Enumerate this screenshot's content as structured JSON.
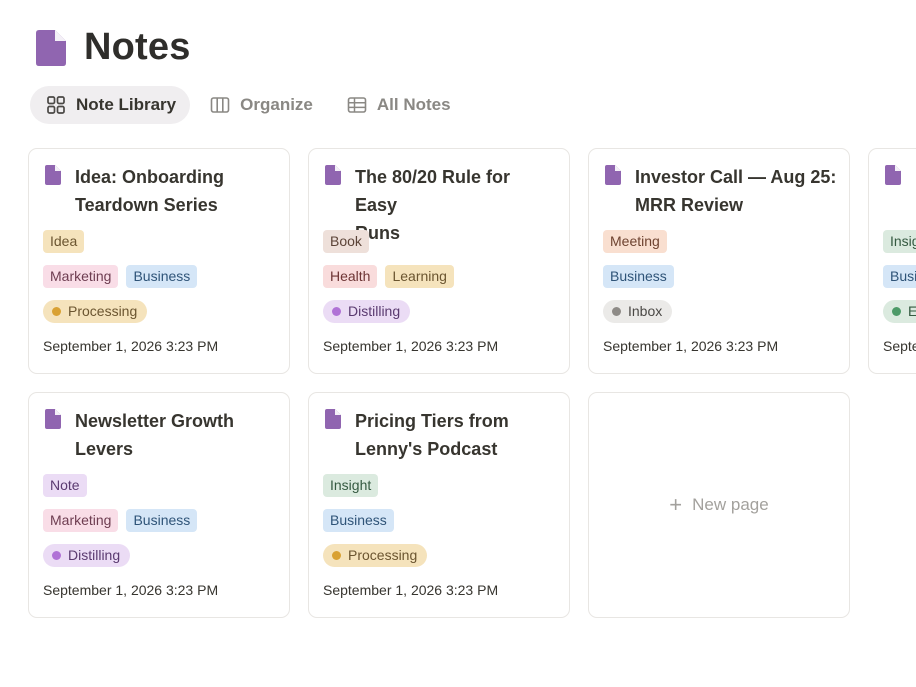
{
  "page": {
    "title": "Notes",
    "icon": "document-icon"
  },
  "tabs": [
    {
      "label": "Note Library",
      "icon": "gallery-icon",
      "active": true
    },
    {
      "label": "Organize",
      "icon": "board-icon",
      "active": false
    },
    {
      "label": "All Notes",
      "icon": "table-icon",
      "active": false
    }
  ],
  "cards": [
    {
      "title_lines": [
        "Idea: Onboarding",
        "Teardown Series"
      ],
      "type_tag": "Idea",
      "topic_tags": [
        "Marketing",
        "Business"
      ],
      "status": "Processing",
      "date": "September 1, 2026 3:23 PM"
    },
    {
      "title_lines": [
        "The 80/20 Rule for Easy",
        "Runs"
      ],
      "type_tag": "Book",
      "topic_tags": [
        "Health",
        "Learning"
      ],
      "status": "Distilling",
      "date": "September 1, 2026 3:23 PM"
    },
    {
      "title_lines": [
        "Investor Call — Aug 25:",
        "MRR Review"
      ],
      "type_tag": "Meeting",
      "topic_tags": [
        "Business"
      ],
      "status": "Inbox",
      "date": "September 1, 2026 3:23 PM"
    },
    {
      "title_lines": [
        "",
        ""
      ],
      "type_tag": "Insig",
      "topic_tags": [
        "Busi"
      ],
      "status": "E",
      "date": "Septe"
    },
    {
      "title_lines": [
        "Newsletter Growth",
        "Levers"
      ],
      "type_tag": "Note",
      "topic_tags": [
        "Marketing",
        "Business"
      ],
      "status": "Distilling",
      "date": "September 1, 2026 3:23 PM"
    },
    {
      "title_lines": [
        "Pricing Tiers from",
        "Lenny's Podcast"
      ],
      "type_tag": "Insight",
      "topic_tags": [
        "Business"
      ],
      "status": "Processing",
      "date": "September 1, 2026 3:23 PM"
    }
  ],
  "new_page": {
    "label": "New page"
  },
  "colors": {
    "icon_purple": "#9065b0",
    "tag_idea": "#f5e3bc",
    "tag_book": "#eee0da",
    "tag_meeting": "#f9dfd0",
    "tag_note": "#ebdcf5",
    "tag_insight": "#dbeadf",
    "tag_marketing": "#f9dde7",
    "tag_business": "#d5e6f7",
    "tag_health": "#f9dcdc",
    "tag_learning": "#f5e3bc",
    "status_processing_bg": "#f5e3bc",
    "status_processing_dot": "#d9a133",
    "status_distilling_bg": "#ebdcf5",
    "status_distilling_dot": "#b072d6",
    "status_inbox_bg": "#ebeae8",
    "status_inbox_dot": "#8e8b87",
    "status_evergreen_bg": "#dbeadf",
    "status_evergreen_dot": "#4d9a68"
  }
}
